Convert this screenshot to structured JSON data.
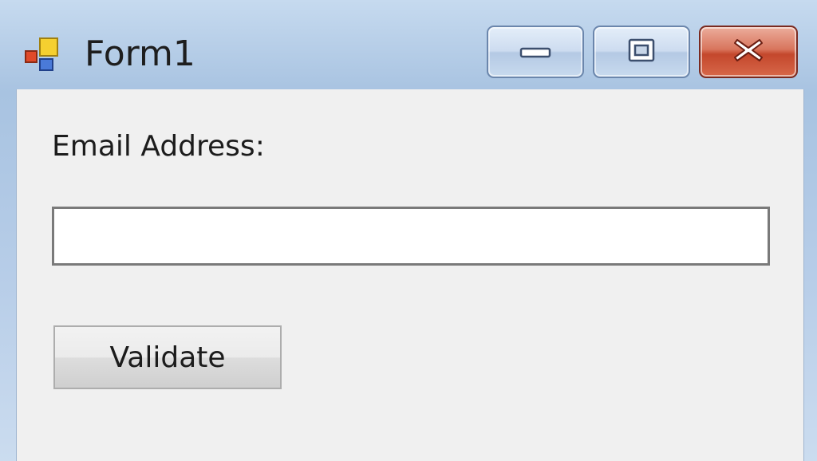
{
  "window": {
    "title": "Form1",
    "icons": {
      "app": "winforms-app-icon",
      "minimize": "minimize-icon",
      "maximize": "maximize-icon",
      "close": "close-icon"
    }
  },
  "form": {
    "email_label": "Email Address:",
    "email_value": "",
    "validate_label": "Validate"
  },
  "colors": {
    "client_background": "#f0f0f0",
    "close_button": "#c4472c",
    "title_text": "#1e1e1e"
  }
}
